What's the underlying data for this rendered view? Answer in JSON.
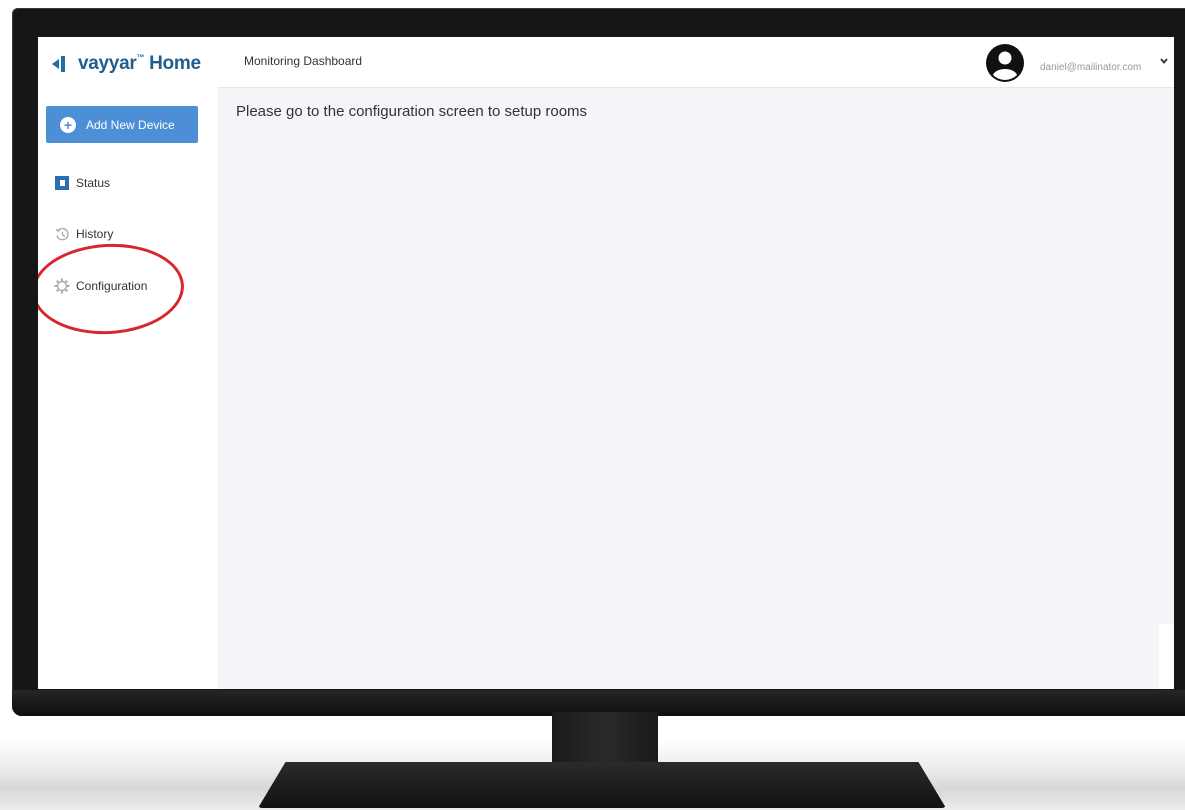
{
  "brand": {
    "name": "vayyar",
    "product": "Home",
    "mark_color": "#1f6fa8",
    "text_color": "#1f5f8f"
  },
  "sidebar": {
    "add_device_label": "Add New Device",
    "add_device_color": "#4d8fd6",
    "items": [
      {
        "label": "Status",
        "icon": "status-icon"
      },
      {
        "label": "History",
        "icon": "history-icon"
      },
      {
        "label": "Configuration",
        "icon": "gear-icon"
      }
    ],
    "highlighted_item": "Configuration",
    "highlight_color": "#d7262e"
  },
  "header": {
    "title": "Monitoring Dashboard",
    "user_email": "daniel@mailinator.com",
    "avatar_icon": "user-avatar-icon",
    "menu_icon": "chevron-down-icon"
  },
  "main": {
    "message": "Please go to the configuration screen to setup rooms"
  }
}
